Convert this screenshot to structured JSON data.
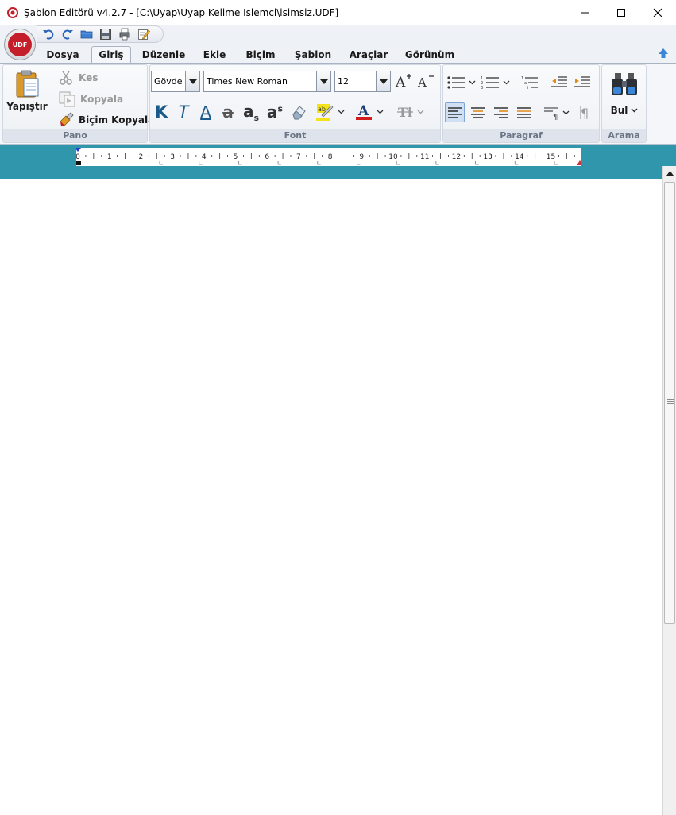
{
  "window": {
    "title": "Şablon Editörü v4.2.7 - [C:\\Uyap\\Uyap Kelime Islemci\\isimsiz.UDF]"
  },
  "app_orb": {
    "label": "UDF"
  },
  "tabs": [
    {
      "label": "Dosya",
      "active": false
    },
    {
      "label": "Giriş",
      "active": true
    },
    {
      "label": "Düzenle",
      "active": false
    },
    {
      "label": "Ekle",
      "active": false
    },
    {
      "label": "Biçim",
      "active": false
    },
    {
      "label": "Şablon",
      "active": false
    },
    {
      "label": "Araçlar",
      "active": false
    },
    {
      "label": "Görünüm",
      "active": false
    }
  ],
  "ribbon": {
    "pano": {
      "label": "Pano",
      "paste": "Yapıştır",
      "cut": "Kes",
      "copy": "Kopyala",
      "format_painter": "Biçim Kopyala"
    },
    "font": {
      "label": "Font",
      "style_value": "Gövde",
      "font_value": "Times New Roman",
      "size_value": "12",
      "bold": "K",
      "italic": "T",
      "underline": "A",
      "strike": "a",
      "subscript": "a",
      "subscript_mark": "s",
      "superscript": "a",
      "superscript_mark": "s",
      "grow": "A",
      "shrink": "A"
    },
    "paragraph": {
      "label": "Paragraf"
    },
    "search": {
      "label": "Arama",
      "find": "Bul"
    }
  },
  "ruler": {
    "numbers": [
      "0",
      "1",
      "2",
      "3",
      "4",
      "5",
      "6",
      "7",
      "8",
      "9",
      "10",
      "11",
      "12",
      "13",
      "14",
      "15"
    ]
  },
  "colors": {
    "ruler_band": "#2f96ab",
    "font_color": "#d01e1e",
    "highlight": "#f4e21b",
    "accent_blue": "#1f5fbf"
  }
}
